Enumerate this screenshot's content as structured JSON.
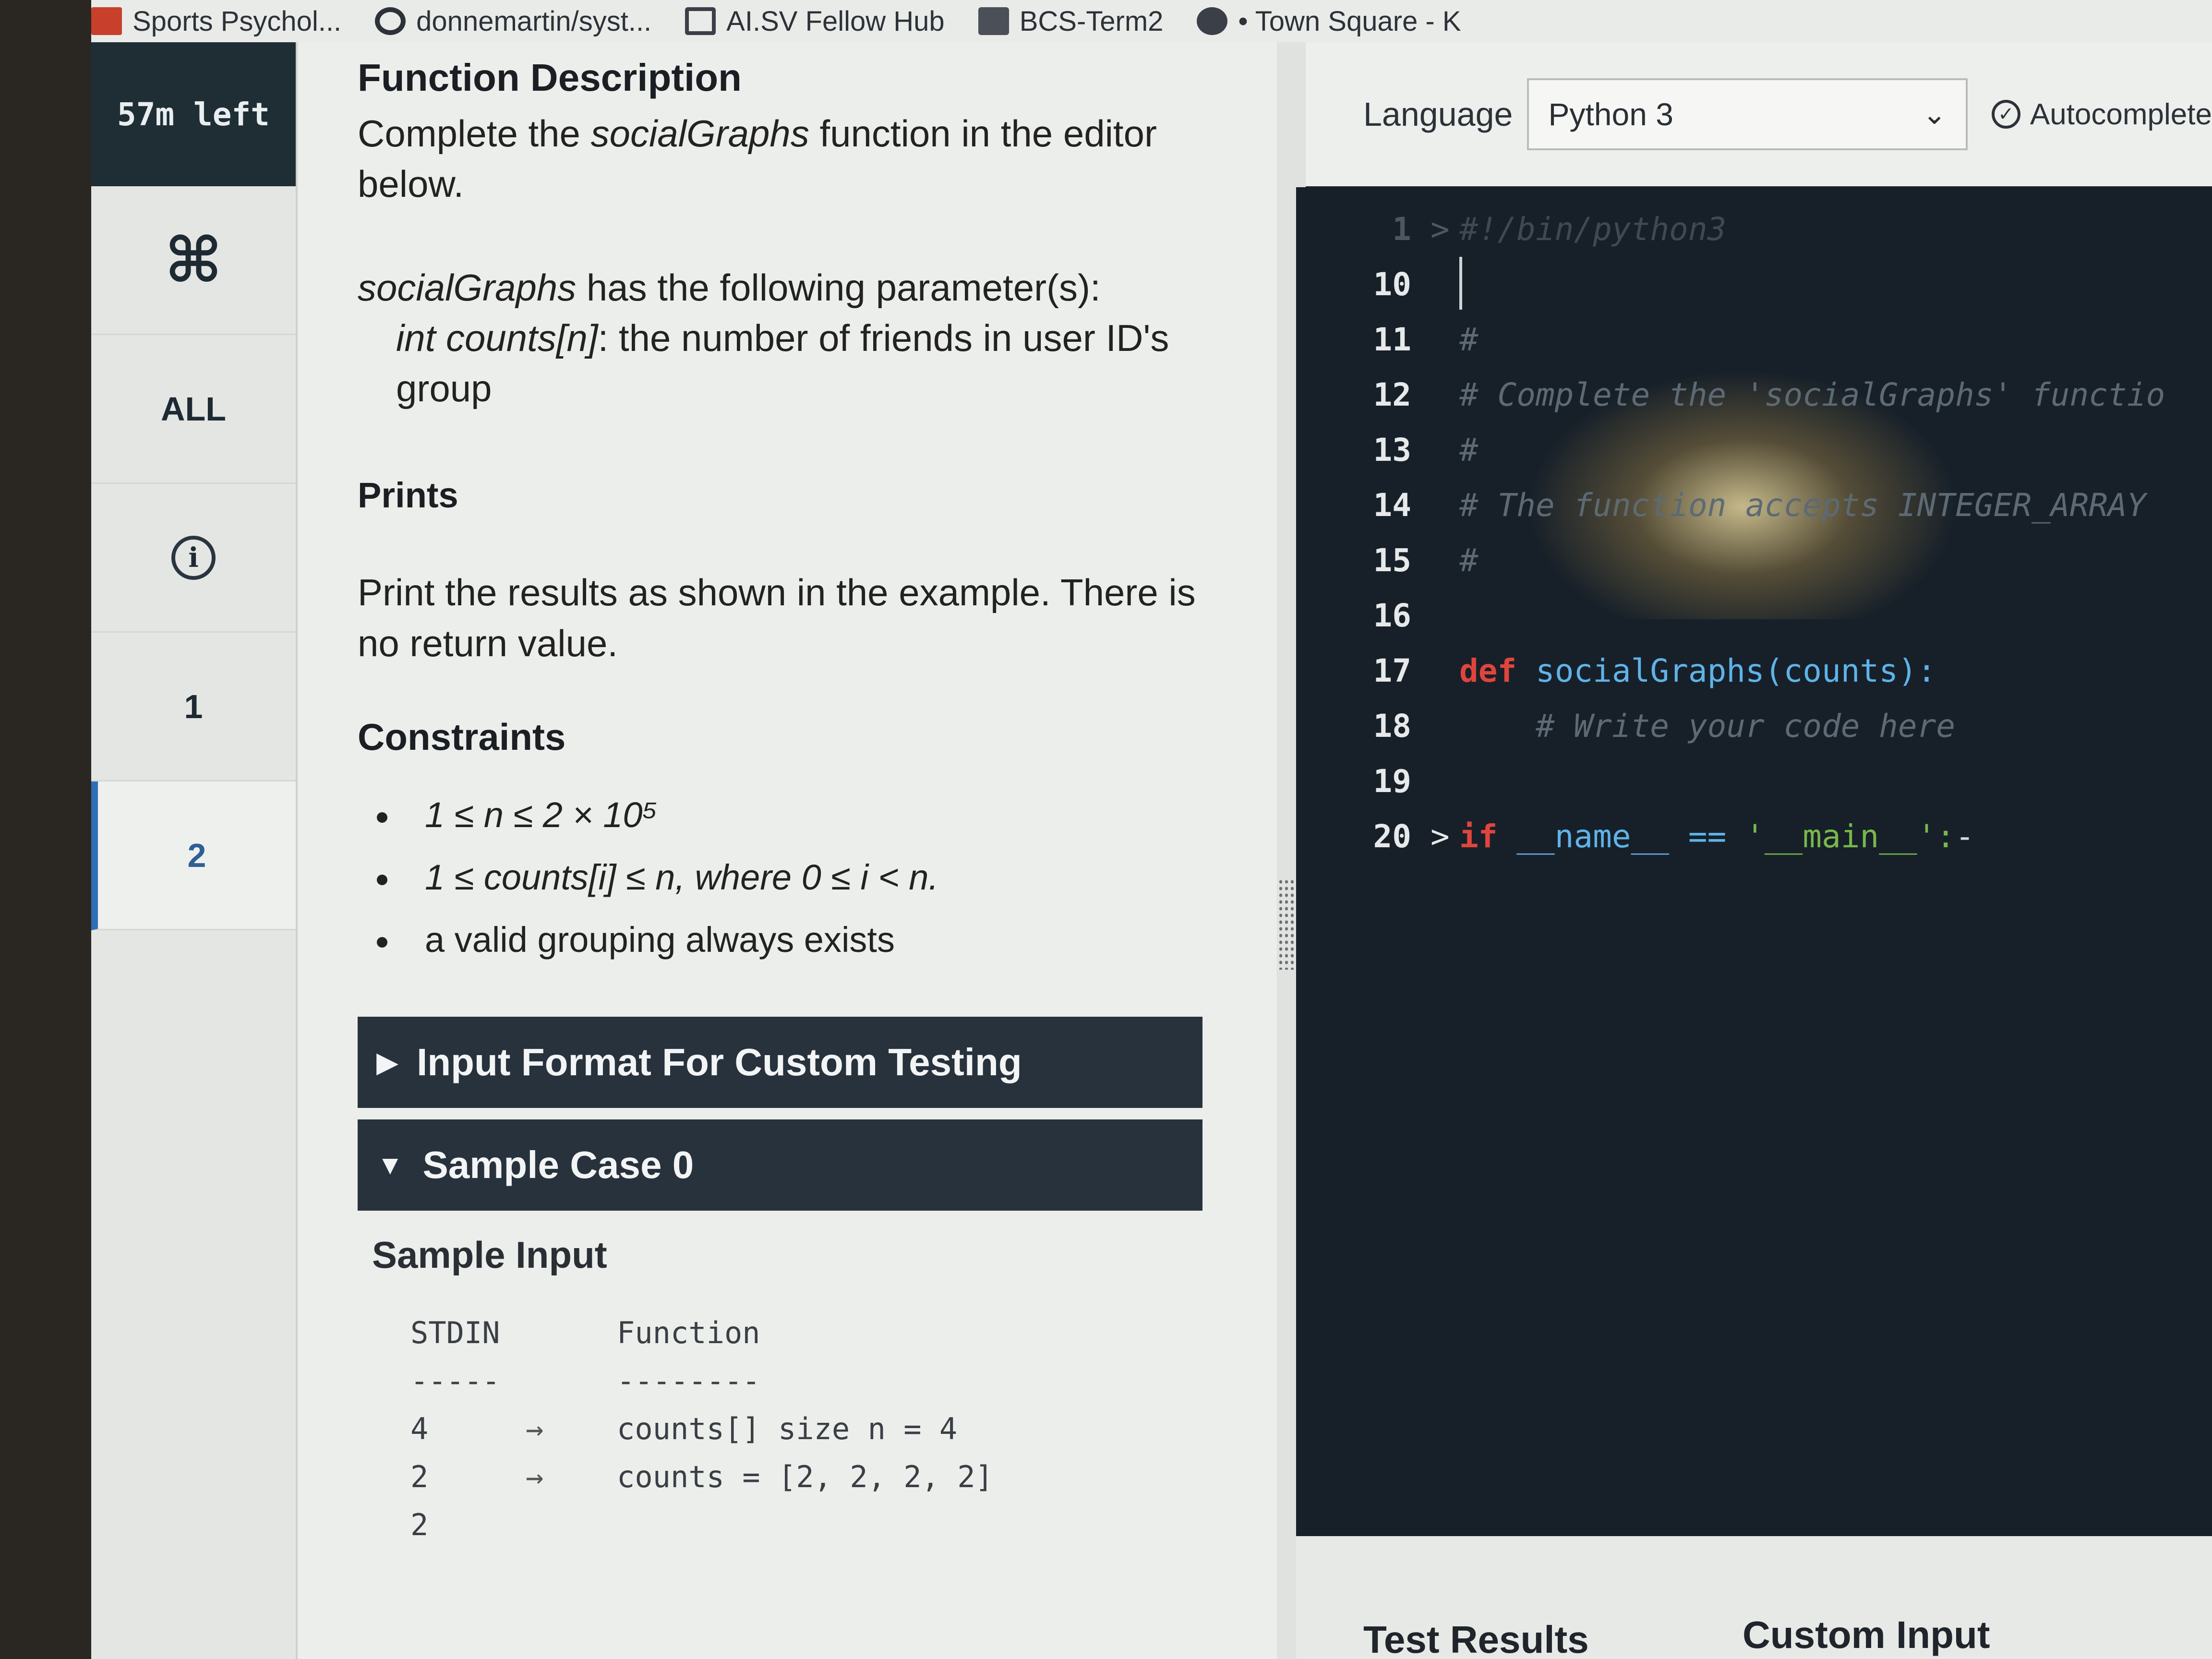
{
  "bookmarks": [
    {
      "label": "Sports Psychol...",
      "icon": "folder-icon"
    },
    {
      "label": "donnemartin/syst...",
      "icon": "github-icon"
    },
    {
      "label": "AI.SV Fellow Hub",
      "icon": "box-icon"
    },
    {
      "label": "BCS-Term2",
      "icon": "folder-icon"
    },
    {
      "label": "• Town Square - K",
      "icon": "globe-icon"
    }
  ],
  "nav": {
    "timer": "57m left",
    "cmd_icon": "⌘",
    "all": "ALL",
    "info_icon": "i",
    "q1": "1",
    "q2": "2"
  },
  "problem": {
    "heading": "Function Description",
    "intro_pre": "Complete the ",
    "intro_fn": "socialGraphs",
    "intro_post": " function in the editor below.",
    "params_fn": "socialGraphs",
    "params_text": " has the following parameter(s):",
    "param_name": "int counts[n]",
    "param_desc": ": the number of friends in user ID's group",
    "prints_heading": "Prints",
    "prints_text": "Print the results as shown in the example. There is no return value.",
    "constraints_heading": "Constraints",
    "constraints": [
      "1 ≤ n ≤ 2 × 10⁵",
      "1 ≤ counts[i] ≤ n, where 0 ≤ i < n.",
      "a valid grouping always exists"
    ],
    "input_format_label": "Input Format For Custom Testing",
    "sample_case_label": "Sample Case 0",
    "sample_input_label": "Sample Input",
    "stdin_header": [
      "STDIN",
      "",
      "Function"
    ],
    "stdin_rule": [
      "-----",
      "",
      "--------"
    ],
    "stdin_rows": [
      [
        "4",
        "→",
        "counts[] size n = 4"
      ],
      [
        "2",
        "→",
        "counts = [2, 2, 2, 2]"
      ],
      [
        "2",
        "",
        ""
      ]
    ]
  },
  "editor": {
    "language_label": "Language",
    "language_value": "Python 3",
    "autocomplete_label": "Autocomplete",
    "lines": [
      {
        "n": "1",
        "fold": ">",
        "text": "#!/bin/python3"
      },
      {
        "n": "10",
        "fold": "",
        "text": ""
      },
      {
        "n": "11",
        "fold": "",
        "text": "#"
      },
      {
        "n": "12",
        "fold": "",
        "text": "# Complete the 'socialGraphs' functio"
      },
      {
        "n": "13",
        "fold": "",
        "text": "#"
      },
      {
        "n": "14",
        "fold": "",
        "text": "# The function accepts INTEGER_ARRAY"
      },
      {
        "n": "15",
        "fold": "",
        "text": "#"
      },
      {
        "n": "16",
        "fold": "",
        "text": ""
      },
      {
        "n": "17",
        "fold": "",
        "kw": "def ",
        "fn": "socialGraphs(counts):"
      },
      {
        "n": "18",
        "fold": "",
        "text": "    # Write your code here"
      },
      {
        "n": "19",
        "fold": "",
        "text": ""
      },
      {
        "n": "20",
        "fold": ">",
        "kw": "if ",
        "plain": "__name__ == ",
        "str": "'__main__':",
        "tail": "-"
      }
    ]
  },
  "bottom_tabs": {
    "test_results": "Test Results",
    "custom_input": "Custom Input"
  },
  "colors": {
    "editor_bg": "#172029",
    "keyword": "#e0453d",
    "function": "#5fb3e8",
    "string": "#78b84a",
    "accordion_bg": "#27323c",
    "active_nav_accent": "#2f6fb5"
  }
}
